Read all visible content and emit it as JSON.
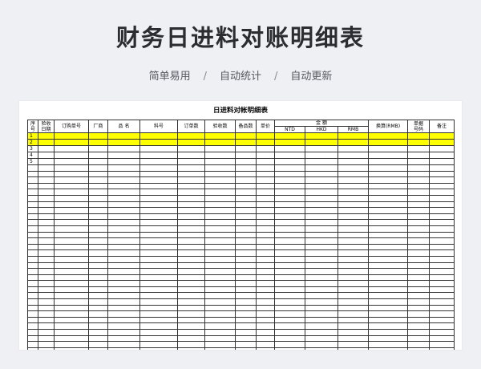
{
  "header": {
    "title": "财务日进料对账明细表",
    "subtitle_items": [
      "简单易用",
      "自动统计",
      "自动更新"
    ],
    "separator": "/"
  },
  "sheet": {
    "title": "日进料对帐明细表",
    "columns": {
      "seq": "序\n号",
      "date": "验收\n日期",
      "order": "订购单号",
      "vendor": "厂商",
      "name": "品 名",
      "part": "料号",
      "order_qty": "订单数",
      "recv_qty": "验收数",
      "spare_qty": "备品数",
      "unit_price": "单价",
      "amount": "金  额",
      "ntd": "NTD",
      "hkd": "HKD",
      "rmb": "RMB",
      "converted": "换算(RMB)",
      "doc_no": "单据\n号码",
      "remark": "备注"
    },
    "row_numbers": [
      "1",
      "2",
      "3",
      "4",
      "5"
    ],
    "highlight_rows": [
      0,
      1
    ],
    "highlight_color": "#ffff00",
    "total_rows": 37
  }
}
